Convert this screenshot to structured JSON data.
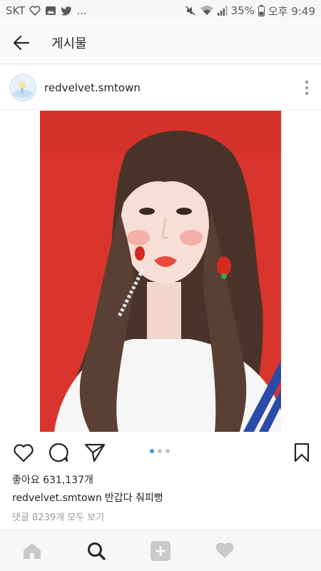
{
  "status_bar": {
    "carrier": "SKT",
    "more_indicator": "...",
    "battery_percent": "35%",
    "time": "오후 9:49",
    "icons": [
      "heart-outline-icon",
      "image-icon",
      "twitter-icon",
      "mute-icon",
      "wifi-icon",
      "signal-icon",
      "battery-icon"
    ]
  },
  "header": {
    "title": "게시물",
    "back_icon": "arrow-left-icon"
  },
  "post": {
    "username": "redvelvet.smtown",
    "more_icon": "vertical-dots-icon",
    "likes_text": "좋아요 631,137개",
    "caption_user": "redvelvet.smtown",
    "caption_text": "반갑다 춰피뻥",
    "comments_text": "댓글 8239개 모두 보기",
    "carousel": {
      "count": 3,
      "active_index": 0
    }
  },
  "actions": {
    "icons": [
      "heart-outline-icon",
      "comment-icon",
      "share-icon",
      "bookmark-icon"
    ]
  },
  "bottom_nav": {
    "icons": [
      "home-icon",
      "search-icon",
      "add-icon",
      "activity-heart-icon"
    ]
  },
  "colors": {
    "photo_background": "#d9352d",
    "carousel_active": "#3897f0",
    "text_primary": "#262626",
    "text_secondary": "#9a9a9a"
  }
}
